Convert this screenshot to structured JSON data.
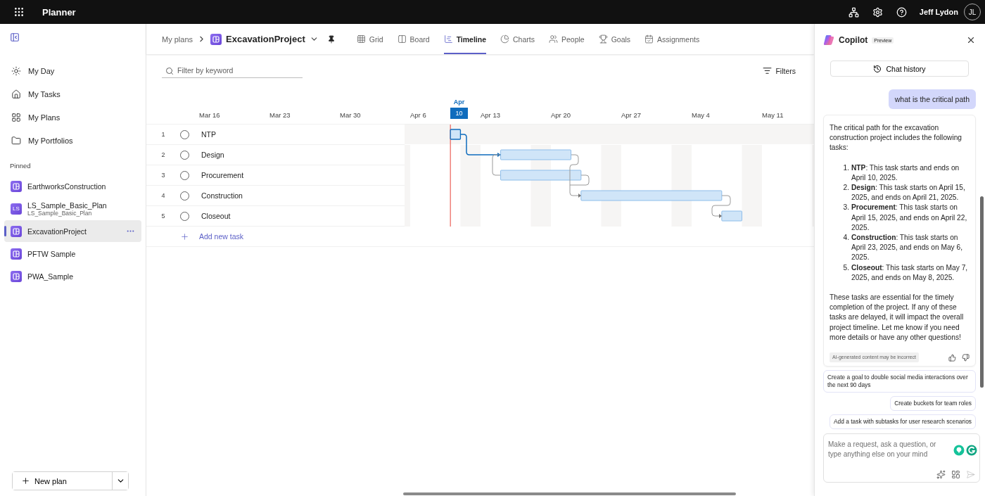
{
  "app": {
    "title": "Planner"
  },
  "user": {
    "name": "Jeff Lydon",
    "initials": "JL"
  },
  "sidebar": {
    "nav": [
      {
        "label": "My Day",
        "kind": "day"
      },
      {
        "label": "My Tasks",
        "kind": "tasks"
      },
      {
        "label": "My Plans",
        "kind": "plans"
      },
      {
        "label": "My Portfolios",
        "kind": "portfolios"
      }
    ],
    "pinned_label": "Pinned",
    "pinned": [
      {
        "name": "EarthworksConstruction",
        "selected": false
      },
      {
        "name": "LS_Sample_Basic_Plan",
        "subtitle": "LS_Sample_Basic_Plan",
        "badge": "LS",
        "selected": false
      },
      {
        "name": "ExcavationProject",
        "selected": true
      },
      {
        "name": "PFTW Sample",
        "selected": false
      },
      {
        "name": "PWA_Sample",
        "selected": false
      }
    ],
    "new_plan": "New plan"
  },
  "breadcrumb": {
    "root": "My plans",
    "plan": "ExcavationProject"
  },
  "tabs": [
    {
      "label": "Grid",
      "kind": "grid",
      "selected": false
    },
    {
      "label": "Board",
      "kind": "board",
      "selected": false
    },
    {
      "label": "Timeline",
      "kind": "timeline",
      "selected": true
    },
    {
      "label": "Charts",
      "kind": "charts",
      "selected": false
    },
    {
      "label": "People",
      "kind": "people",
      "selected": false
    },
    {
      "label": "Goals",
      "kind": "goals",
      "selected": false
    },
    {
      "label": "Assignments",
      "kind": "assignments",
      "selected": false
    }
  ],
  "filter": {
    "placeholder": "Filter by keyword"
  },
  "filters_button": "Filters",
  "timeline": {
    "month": "Apr",
    "today": "10",
    "weeks": [
      "Mar 16",
      "Mar 23",
      "Mar 30",
      "Apr 6",
      "Apr 13",
      "Apr 20",
      "Apr 27",
      "May 4",
      "May 11"
    ],
    "tasks": [
      {
        "number": "1",
        "name": "NTP",
        "completed": false
      },
      {
        "number": "2",
        "name": "Design",
        "completed": false
      },
      {
        "number": "3",
        "name": "Procurement",
        "completed": false
      },
      {
        "number": "4",
        "name": "Construction",
        "completed": false
      },
      {
        "number": "5",
        "name": "Closeout",
        "completed": false
      }
    ],
    "add_task": "Add new task"
  },
  "copilot": {
    "title": "Copilot",
    "badge": "Preview",
    "chat_history": "Chat history",
    "question": "what is the critical path",
    "intro": "The critical path for the excavation construction project includes the following tasks:",
    "items": [
      {
        "number": "1.",
        "text": "**NTP**: This task starts and ends on April 10, 2025."
      },
      {
        "number": "2.",
        "text": "**Design**: This task starts on April 15, 2025, and ends on April 21, 2025."
      },
      {
        "number": "3.",
        "text": "**Procurement**: This task starts on April 15, 2025, and ends on April 22, 2025."
      },
      {
        "number": "4.",
        "text": "**Construction**: This task starts on April 23, 2025, and ends on May 6, 2025."
      },
      {
        "number": "5.",
        "text": "**Closeout**: This task starts on May 7, 2025, and ends on May 8, 2025."
      }
    ],
    "outro": "These tasks are essential for the timely completion of the project. If any of these tasks are delayed, it will impact the overall project timeline. Let me know if you need more details or have any other questions!",
    "disclaimer": "AI-generated content may be incorrect",
    "suggestions": [
      "Create a goal to double social media interactions over the next 90 days",
      "Create buckets for team roles",
      "Add a task with subtasks for user research scenarios"
    ],
    "input_placeholder": "Make a request, ask a question, or type anything else on your mind"
  }
}
